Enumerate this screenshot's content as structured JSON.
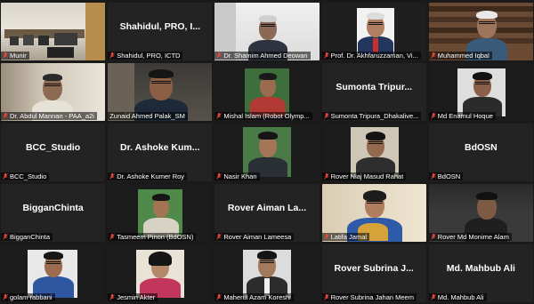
{
  "colors": {
    "background": "#1a1a1a",
    "tile": "#232323",
    "active_speaker": "#c8d64a",
    "muted_mic": "#e5483c"
  },
  "tiles": [
    {
      "label": "Munir",
      "video": true
    },
    {
      "label": "Shahidul, PRO, ICTD",
      "center": "Shahidul, PRO, I...",
      "video": false
    },
    {
      "label": "Dr. Shamim Ahmed Deowan",
      "video": true
    },
    {
      "label": "Prof. Dr. Akhfaruzzaman, Vi...",
      "video": true
    },
    {
      "label": "Muhammed Iqbal",
      "video": true
    },
    {
      "label": "Dr. Abdul Mannan - PAA_a2i",
      "video": true
    },
    {
      "label": "Zunaid Ahmed Palak_SM",
      "video": true,
      "active": true
    },
    {
      "label": "Mishal Islam (Robot Olymp...",
      "video": true
    },
    {
      "label": "Sumonta Tripura_Dhakalive...",
      "center": "Sumonta Tripur...",
      "video": false
    },
    {
      "label": "Md Enamul Hoque",
      "video": true
    },
    {
      "label": "BCC_Studio",
      "center": "BCC_Studio",
      "video": false
    },
    {
      "label": "Dr. Ashoke Kumer Roy",
      "center": "Dr. Ashoke Kum...",
      "video": false
    },
    {
      "label": "Nasir Khan",
      "video": true
    },
    {
      "label": "Rover Niaj Masud Rahat",
      "video": true
    },
    {
      "label": "BdOSN",
      "center": "BdOSN",
      "video": false
    },
    {
      "label": "BigganChinta",
      "center": "BigganChinta",
      "video": false
    },
    {
      "label": "Tasmeem Pinon (BdOSN)",
      "video": true
    },
    {
      "label": "Rover Aiman Lameesa",
      "center": "Rover Aiman La...",
      "video": false
    },
    {
      "label": "Latifa Jamal",
      "video": true
    },
    {
      "label": "Rover Md Monime Alam",
      "video": true
    },
    {
      "label": "golam rabbani",
      "video": true
    },
    {
      "label": "Jesmin Akter",
      "video": true
    },
    {
      "label": "Maherul Azam Koreshi",
      "video": true
    },
    {
      "label": "Rover Subrina Jahan Meem",
      "center": "Rover Subrina J...",
      "video": false
    },
    {
      "label": "Md. Mahbub Ali",
      "center": "Md. Mahbub Ali",
      "video": false
    }
  ]
}
